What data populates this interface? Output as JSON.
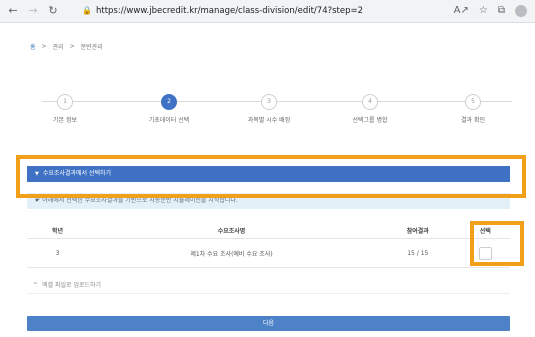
{
  "browser": {
    "url": "https://www.jbecredit.kr/manage/class-division/edit/74?step=2",
    "icons": [
      "back-icon",
      "forward-icon",
      "reload-icon",
      "lock-icon",
      "reader-mode-icon",
      "favorites-icon",
      "collections-icon",
      "profile-icon"
    ]
  },
  "breadcrumb": {
    "home": "홈",
    "separator": ">",
    "items": [
      "관리",
      "분반관리"
    ]
  },
  "stepper": {
    "active_index": 1,
    "steps": [
      {
        "number": "1",
        "label": "기본 정보"
      },
      {
        "number": "2",
        "label": "기초데이터 선택"
      },
      {
        "number": "3",
        "label": "과목별 시수 배정"
      },
      {
        "number": "4",
        "label": "선택그룹 병합"
      },
      {
        "number": "5",
        "label": "결과 확인"
      }
    ]
  },
  "section": {
    "title": "수요조사결과에서 선택하기",
    "info": "아래에서 선택한 수요조사결과를 기반으로 자동분반 시뮬레이션을 시작합니다."
  },
  "table": {
    "headers": {
      "grade": "학년",
      "survey_name": "수요조사명",
      "participation": "참여결과",
      "select": "선택"
    },
    "rows": [
      {
        "grade": "3",
        "survey_name": "제1차 수요 조사(예비 수요 조사)",
        "participation": "15 / 15",
        "selected": false
      }
    ]
  },
  "excel": {
    "label": "엑셀 파일로 업로드하기"
  },
  "buttons": {
    "next": "다음"
  },
  "colors": {
    "primary": "#3f72c4",
    "highlight": "#f2a01a",
    "info_bg": "#e4f0f8"
  }
}
